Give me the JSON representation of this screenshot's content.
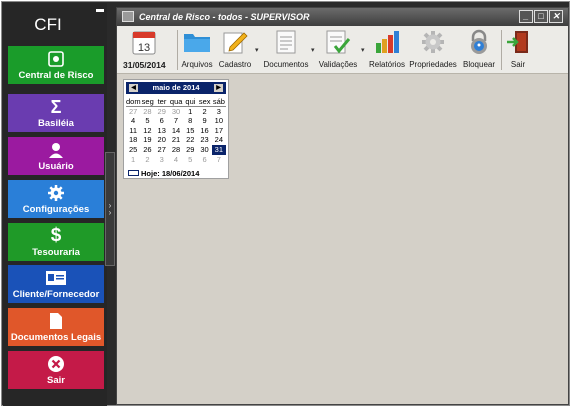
{
  "sidebar": {
    "title": "CFI",
    "tiles": [
      {
        "label": "Central de Risco",
        "icon": "gear-box-icon",
        "color": "#1a9c2a"
      },
      {
        "label": "Basiléia",
        "icon": "sigma-icon",
        "color": "#6a3cb0"
      },
      {
        "label": "Usuário",
        "icon": "user-icon",
        "color": "#9b1aa0"
      },
      {
        "label": "Configurações",
        "icon": "gear-icon",
        "color": "#2a7fd8"
      },
      {
        "label": "Tesouraria",
        "icon": "dollar-icon",
        "color": "#1f9a28"
      },
      {
        "label": "Cliente/Fornecedor",
        "icon": "id-card-icon",
        "color": "#1a52b8"
      },
      {
        "label": "Documentos Legais",
        "icon": "document-icon",
        "color": "#e0572a"
      },
      {
        "label": "Sair",
        "icon": "close-circle-icon",
        "color": "#c41a48"
      }
    ]
  },
  "window": {
    "title": "Central de Risco - todos - SUPERVISOR",
    "buttons": {
      "minimize": "_",
      "maximize": "□",
      "close": "✕"
    }
  },
  "toolbar": {
    "date": "31/05/2014",
    "items": [
      {
        "label": "Arquivos",
        "icon": "folder-icon"
      },
      {
        "label": "Cadastro",
        "icon": "pencil-note-icon"
      },
      {
        "label": "Documentos",
        "icon": "document-lines-icon"
      },
      {
        "label": "Validações",
        "icon": "checklist-icon"
      },
      {
        "label": "Relatórios",
        "icon": "bar-chart-icon"
      },
      {
        "label": "Propriedades",
        "icon": "gear-icon"
      },
      {
        "label": "Bloquear",
        "icon": "lock-icon"
      },
      {
        "label": "Sair",
        "icon": "exit-door-icon"
      }
    ],
    "calendar_icon_day": "13"
  },
  "calendar": {
    "month_label": "maio de 2014",
    "weekdays": [
      "dom",
      "seg",
      "ter",
      "qua",
      "qui",
      "sex",
      "sáb"
    ],
    "weeks": [
      [
        "27",
        "28",
        "29",
        "30",
        "1",
        "2",
        "3"
      ],
      [
        "4",
        "5",
        "6",
        "7",
        "8",
        "9",
        "10"
      ],
      [
        "11",
        "12",
        "13",
        "14",
        "15",
        "16",
        "17"
      ],
      [
        "18",
        "19",
        "20",
        "21",
        "22",
        "23",
        "24"
      ],
      [
        "25",
        "26",
        "27",
        "28",
        "29",
        "30",
        "31"
      ],
      [
        "1",
        "2",
        "3",
        "4",
        "5",
        "6",
        "7"
      ]
    ],
    "selected_day": "31",
    "today_label": "Hoje: 18/06/2014"
  }
}
